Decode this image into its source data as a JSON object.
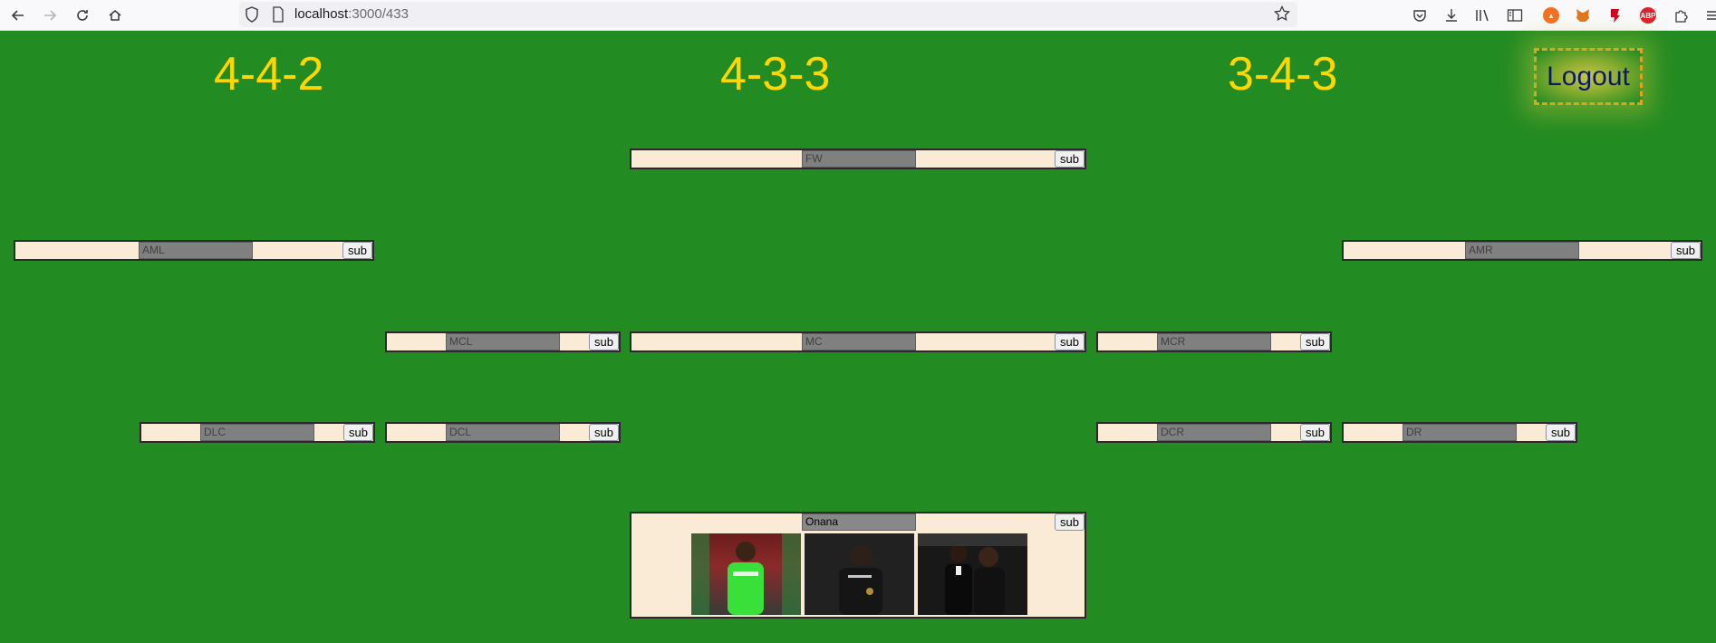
{
  "browser": {
    "url_host": "localhost",
    "url_path": ":3000/433"
  },
  "page": {
    "formations": [
      "4-4-2",
      "4-3-3",
      "3-4-3"
    ],
    "logout_label": "Logout",
    "sub_label": "sub",
    "positions": {
      "fw": "FW",
      "aml": "AML",
      "amr": "AMR",
      "mcl": "MCL",
      "mc": "MC",
      "mcr": "MCR",
      "dlc": "DLC",
      "dcl": "DCL",
      "dcr": "DCR",
      "dr": "DR",
      "gk": "Onana"
    }
  }
}
